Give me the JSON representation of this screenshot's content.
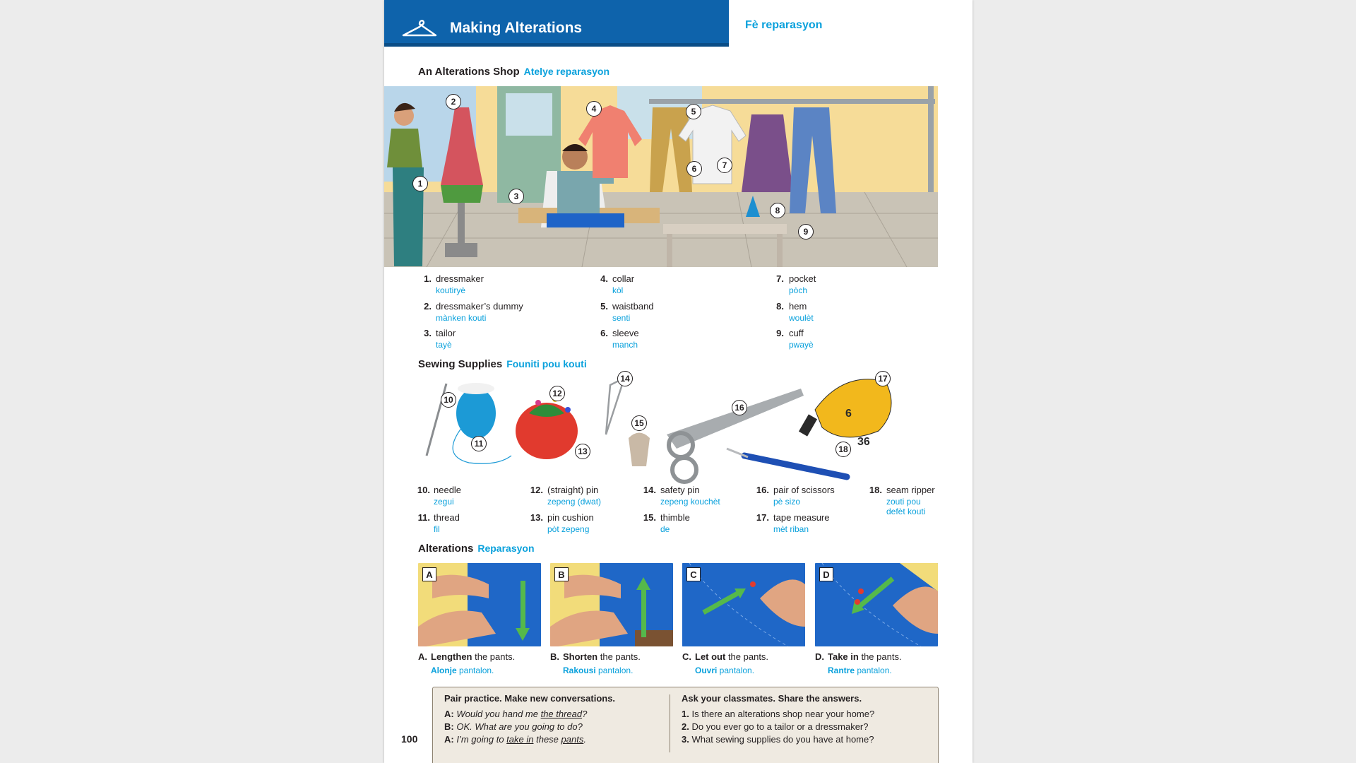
{
  "header": {
    "title": "Making Alterations",
    "title_ht": "Fè reparasyon",
    "icon": "hanger-icon"
  },
  "shop": {
    "heading": "An Alterations Shop",
    "heading_ht": "Atelye reparasyon",
    "vocab": [
      {
        "n": "1.",
        "en": "dressmaker",
        "ht": "koutiryè"
      },
      {
        "n": "2.",
        "en": "dressmaker’s dummy",
        "ht": "mànken kouti"
      },
      {
        "n": "3.",
        "en": "tailor",
        "ht": "tayè"
      },
      {
        "n": "4.",
        "en": "collar",
        "ht": "kòl"
      },
      {
        "n": "5.",
        "en": "waistband",
        "ht": "senti"
      },
      {
        "n": "6.",
        "en": "sleeve",
        "ht": "manch"
      },
      {
        "n": "7.",
        "en": "pocket",
        "ht": "pòch"
      },
      {
        "n": "8.",
        "en": "hem",
        "ht": "woulèt"
      },
      {
        "n": "9.",
        "en": "cuff",
        "ht": "pwayè"
      }
    ],
    "callouts": [
      "1",
      "2",
      "3",
      "4",
      "5",
      "6",
      "7",
      "8",
      "9"
    ]
  },
  "supplies": {
    "heading": "Sewing Supplies",
    "heading_ht": "Founiti pou kouti",
    "callouts": [
      "10",
      "11",
      "12",
      "13",
      "14",
      "15",
      "16",
      "17",
      "18"
    ],
    "vocab": [
      {
        "n": "10.",
        "en": "needle",
        "ht": "zegui"
      },
      {
        "n": "11.",
        "en": "thread",
        "ht": "fil"
      },
      {
        "n": "12.",
        "en": "(straight) pin",
        "ht": "zepeng (dwat)"
      },
      {
        "n": "13.",
        "en": "pin cushion",
        "ht": "pòt zepeng"
      },
      {
        "n": "14.",
        "en": "safety pin",
        "ht": "zepeng kouchèt"
      },
      {
        "n": "15.",
        "en": "thimble",
        "ht": "de"
      },
      {
        "n": "16.",
        "en": "pair of scissors",
        "ht": "pè sizo"
      },
      {
        "n": "17.",
        "en": "tape measure",
        "ht": "mèt riban"
      },
      {
        "n": "18.",
        "en": "seam ripper",
        "ht": "zouti pou",
        "ht2": "defèt kouti"
      }
    ],
    "tape_numbers": [
      "6",
      "36"
    ]
  },
  "alterations": {
    "heading": "Alterations",
    "heading_ht": "Reparasyon",
    "items": [
      {
        "letter": "A",
        "label": "A.",
        "verb": "Lengthen",
        "rest": " the pants.",
        "ht_verb": "Alonje",
        "ht_rest": " pantalon."
      },
      {
        "letter": "B",
        "label": "B.",
        "verb": "Shorten",
        "rest": " the pants.",
        "ht_verb": "Rakousi",
        "ht_rest": " pantalon."
      },
      {
        "letter": "C",
        "label": "C.",
        "verb": "Let out",
        "rest": " the pants.",
        "ht_verb": "Ouvri",
        "ht_rest": " pantalon."
      },
      {
        "letter": "D",
        "label": "D.",
        "verb": "Take in",
        "rest": " the pants.",
        "ht_verb": "Rantre",
        "ht_rest": " pantalon."
      }
    ]
  },
  "practice": {
    "left_heading": "Pair practice. Make new conversations.",
    "dialog": [
      {
        "speaker": "A:",
        "pre": "Would you hand me ",
        "u": "the thread",
        "post": "?"
      },
      {
        "speaker": "B:",
        "pre": "OK. What are you going to do?",
        "u": "",
        "post": ""
      },
      {
        "speaker": "A:",
        "pre": "I’m going to ",
        "u": "take in",
        "post": " these ",
        "u2": "pants",
        "post2": "."
      }
    ],
    "right_heading": "Ask your classmates. Share the answers.",
    "questions": [
      {
        "n": "1.",
        "q": "Is there an alterations shop near your home?"
      },
      {
        "n": "2.",
        "q": "Do you ever go to a tailor or a dressmaker?"
      },
      {
        "n": "3.",
        "q": "What sewing supplies do you have at home?"
      }
    ]
  },
  "page_number": "100",
  "colors": {
    "header_blue": "#0e63ab",
    "accent_cyan": "#0aa1dc",
    "box_bg": "#efeae1"
  }
}
